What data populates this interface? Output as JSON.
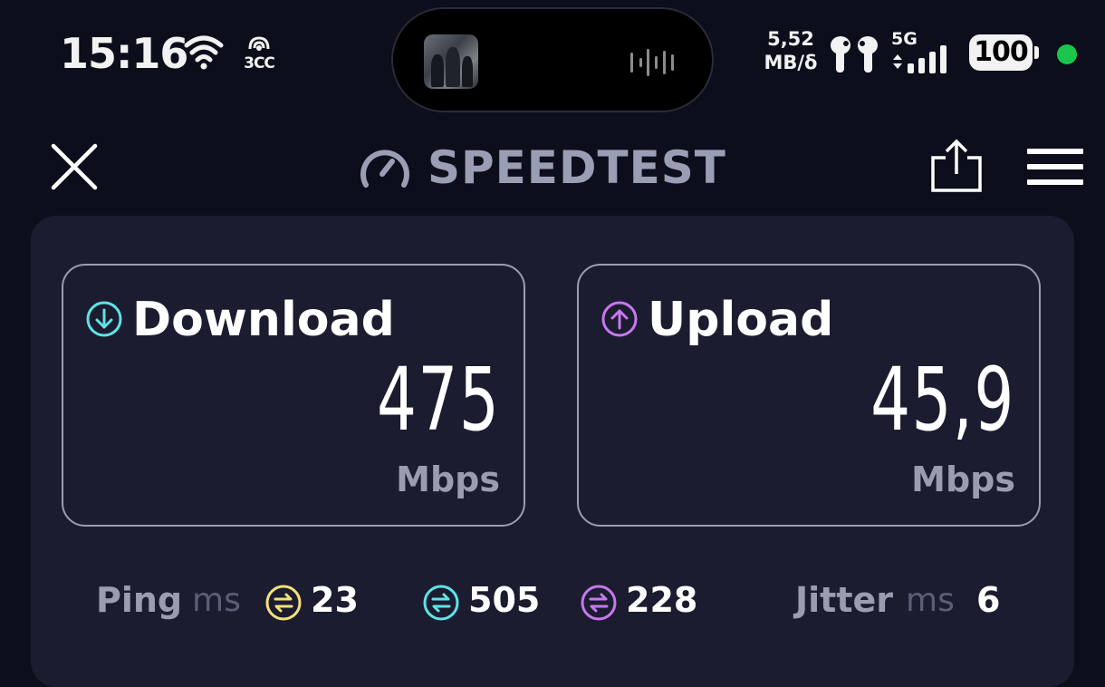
{
  "status_bar": {
    "time": "15:16",
    "hotspot_label": "3CC",
    "net_speed_value": "5,52",
    "net_speed_unit": "MB/δ",
    "network_type": "5G",
    "battery_level": "100",
    "icons": [
      "wifi-icon",
      "hotspot-icon",
      "waveform-icon",
      "earbuds-icon",
      "signal-icon",
      "battery-icon"
    ],
    "privacy_dot_color": "#19c64b"
  },
  "header": {
    "title": "SPEEDTEST",
    "icons": [
      "close-icon",
      "speedometer-icon",
      "share-icon",
      "menu-icon"
    ]
  },
  "results": {
    "download": {
      "label": "Download",
      "value": "475",
      "unit": "Mbps",
      "icon": "download-arrow-icon",
      "color": "#5ee3e6"
    },
    "upload": {
      "label": "Upload",
      "value": "45,9",
      "unit": "Mbps",
      "icon": "upload-arrow-icon",
      "color": "#c678ee"
    }
  },
  "stats": {
    "ping_label": "Ping",
    "ping_unit": "ms",
    "ping_idle": "23",
    "ping_download": "505",
    "ping_upload": "228",
    "jitter_label": "Jitter",
    "jitter_unit": "ms",
    "jitter_value": "6",
    "colors": {
      "idle": "#f3e07a",
      "download": "#5ee3e6",
      "upload": "#c678ee"
    }
  }
}
